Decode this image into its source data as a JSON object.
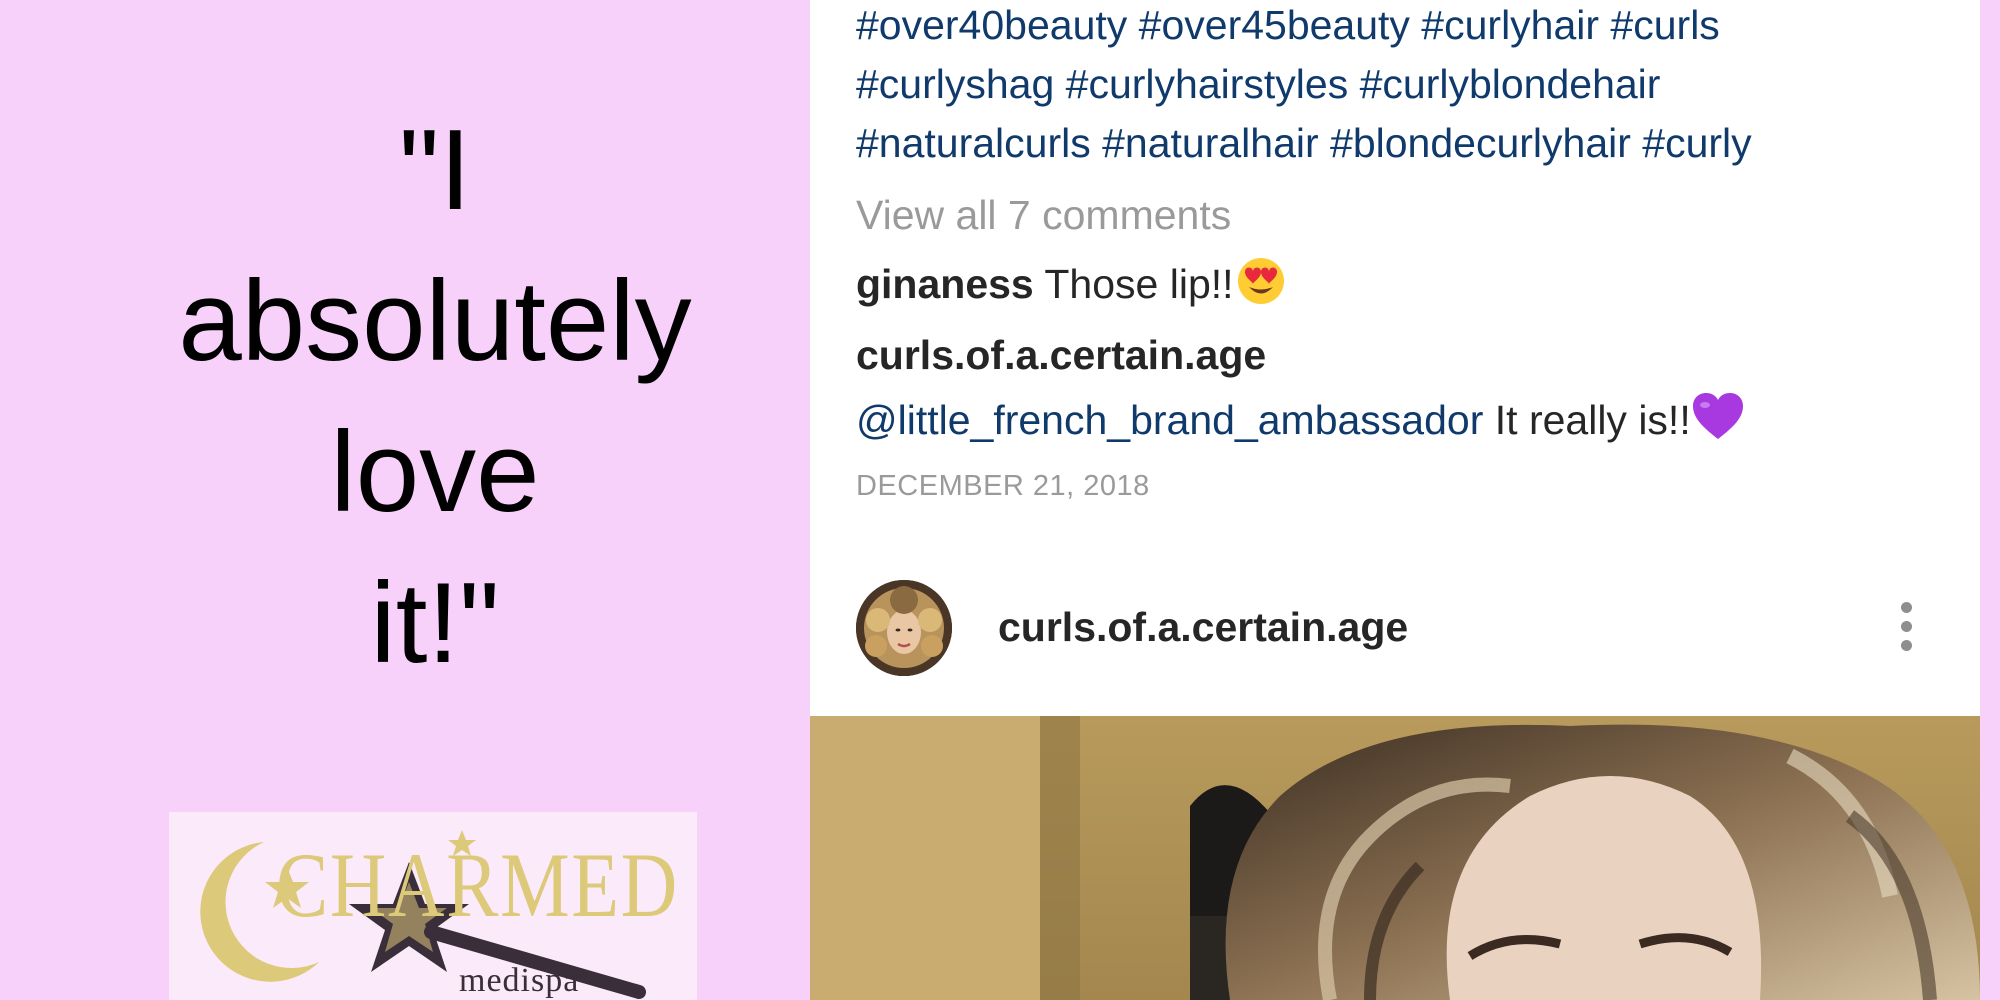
{
  "quote": {
    "lines": [
      "\"I",
      "absolutely",
      "love",
      "it!\""
    ]
  },
  "logo": {
    "name": "CHARMED",
    "subtitle": "medispa"
  },
  "post": {
    "hashtag_lines": [
      "#over40beauty #over45beauty #curlyhair #curls",
      "#curlyshag #curlyhairstyles #curlyblondehair",
      "#naturalcurls #naturalhair #blondecurlyhair #curly"
    ],
    "view_comments": "View all 7 comments",
    "comments": [
      {
        "user": "ginaness",
        "text": "Those lip!!",
        "emoji": "smiling-face-with-heart-eyes"
      },
      {
        "user": "curls.of.a.certain.age",
        "mention": "@little_french_brand_ambassador",
        "text": "It really is!!",
        "emoji": "purple-heart"
      }
    ],
    "date": "DECEMBER 21, 2018",
    "next_post": {
      "username": "curls.of.a.certain.age",
      "menu_icon": "more-vertical-icon"
    }
  },
  "colors": {
    "background_pink": "#f8d1fb",
    "link_blue": "#0f3a6b",
    "muted_gray": "#9a9a9a",
    "text_dark": "#262626"
  }
}
